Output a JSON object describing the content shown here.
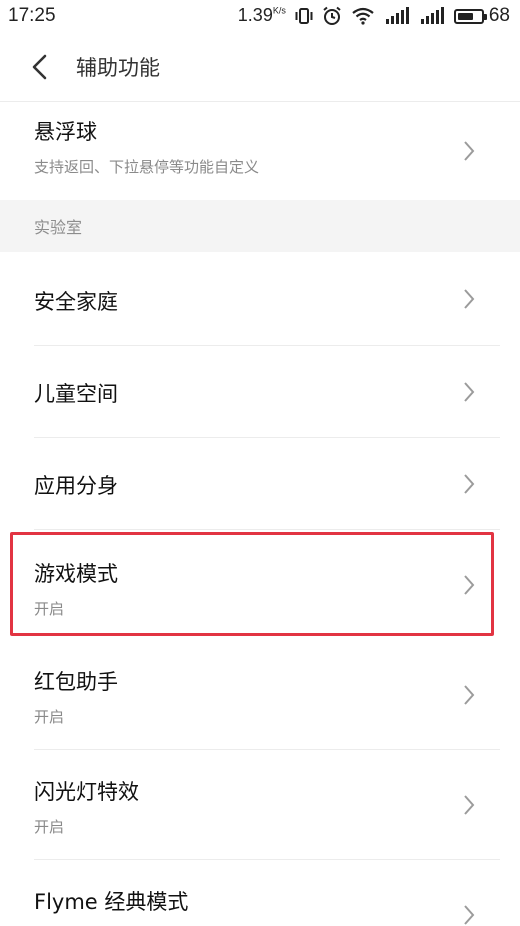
{
  "status_bar": {
    "time": "17:25",
    "net_speed": "1.39",
    "net_speed_unit": "K/s",
    "battery_level": "68",
    "battery_fraction": 0.68
  },
  "nav": {
    "title": "辅助功能"
  },
  "floating_ball": {
    "title": "悬浮球",
    "subtitle": "支持返回、下拉悬停等功能自定义"
  },
  "section": {
    "title": "实验室"
  },
  "items": [
    {
      "title": "安全家庭"
    },
    {
      "title": "儿童空间"
    },
    {
      "title": "应用分身"
    },
    {
      "title": "游戏模式",
      "subtitle": "开启"
    },
    {
      "title": "红包助手",
      "subtitle": "开启"
    },
    {
      "title": "闪光灯特效",
      "subtitle": "开启"
    },
    {
      "title": "Flyme 经典模式"
    }
  ],
  "icons": {
    "back": "back-arrow-icon",
    "chevron": "chevron-right-icon"
  },
  "colors": {
    "highlight": "#e23442",
    "section_bg": "#f4f4f4",
    "subtitle": "#8a8a8a"
  }
}
